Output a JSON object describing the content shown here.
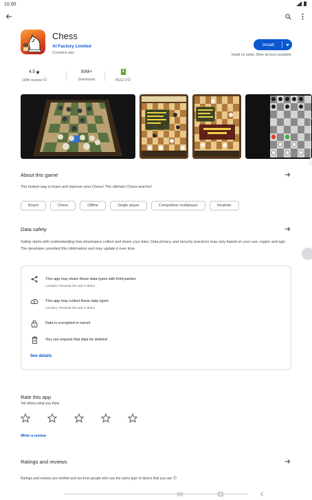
{
  "status_bar": {
    "time": "10.00"
  },
  "app": {
    "title": "Chess",
    "developer": "AI Factory Limited",
    "ads": "Contains ads",
    "install_label": "Install",
    "install_note": "Install on tablet. More devices available."
  },
  "stats": [
    {
      "value": "4.5",
      "label": "144K reviews"
    },
    {
      "value": "50M+",
      "label": "Downloads"
    },
    {
      "value": "",
      "label": "PEGI 3"
    }
  ],
  "pegi_badge": "3",
  "about": {
    "title": "About this game",
    "description": "The fastest way to learn and improve your Chess! The ultimate Chess teacher!"
  },
  "tags": [
    "Board",
    "Chess",
    "Offline",
    "Single player",
    "Competitive multiplayer",
    "Realistic"
  ],
  "data_safety": {
    "title": "Data safety",
    "description": "Safety starts with understanding how developers collect and share your data. Data privacy and security practices may vary based on your use, region and age. The developer provided this information and may update it over time.",
    "rows": [
      {
        "icon": "share-icon",
        "main": "This app may share these data types with third parties",
        "sub": "Location, Personal info and 3 others"
      },
      {
        "icon": "cloud-upload-icon",
        "main": "This app may collect these data types",
        "sub": "Location, Personal info and 3 others"
      },
      {
        "icon": "lock-icon",
        "main": "Data is encrypted in transit",
        "sub": ""
      },
      {
        "icon": "delete-icon",
        "main": "You can request that data be deleted",
        "sub": ""
      }
    ],
    "see_details": "See details"
  },
  "rate": {
    "title": "Rate this app",
    "subtitle": "Tell others what you think",
    "star_count": 5,
    "write_review": "Write a review"
  },
  "ratings": {
    "title": "Ratings and reviews",
    "note": "Ratings and reviews are verified and are from people who use the same type of device that you use"
  },
  "colors": {
    "accent": "#0b57d0",
    "pegi_green": "#5aa631"
  }
}
